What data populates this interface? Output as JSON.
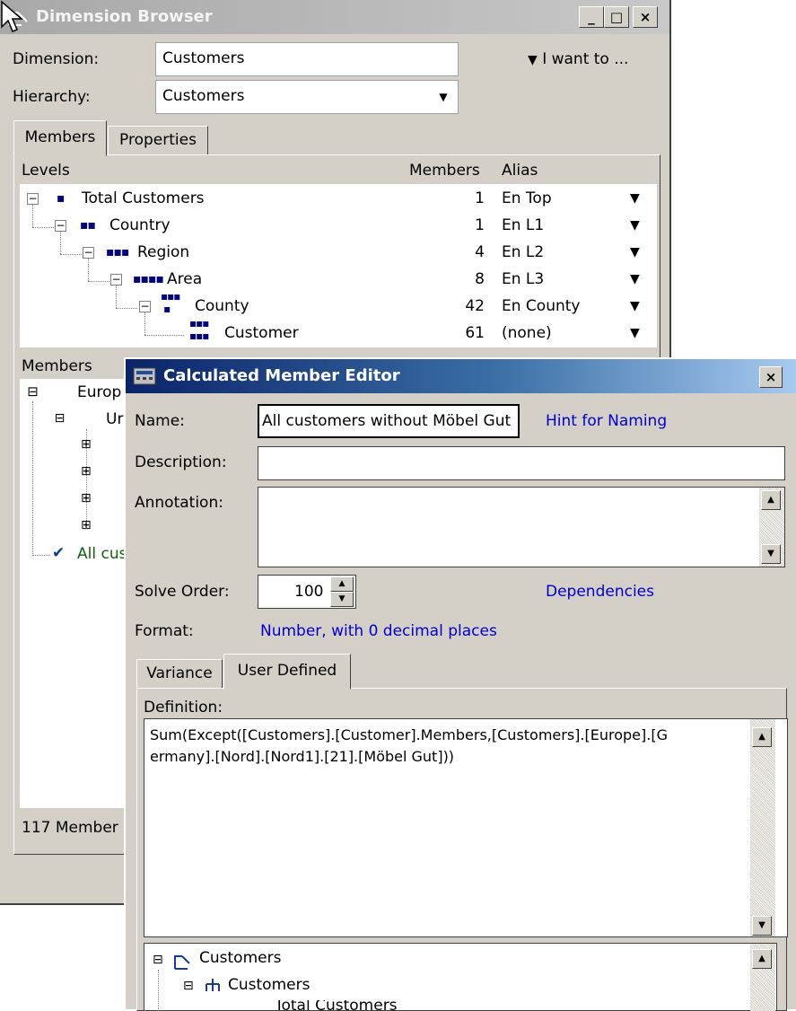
{
  "dimension_browser": {
    "title": "Dimension Browser",
    "dimension_label": "Dimension:",
    "dimension_value": "Customers",
    "hierarchy_label": "Hierarchy:",
    "hierarchy_value": "Customers",
    "i_want_to": "I want to ...",
    "tabs": {
      "members": "Members",
      "properties": "Properties"
    },
    "levels_header": {
      "levels": "Levels",
      "members": "Members",
      "alias": "Alias"
    },
    "levels": [
      {
        "name": "Total Customers",
        "count": "1",
        "alias": "En Top"
      },
      {
        "name": "Country",
        "count": "1",
        "alias": "En L1"
      },
      {
        "name": "Region",
        "count": "4",
        "alias": "En L2"
      },
      {
        "name": "Area",
        "count": "8",
        "alias": "En L3"
      },
      {
        "name": "County",
        "count": "42",
        "alias": "En County"
      },
      {
        "name": "Customer",
        "count": "61",
        "alias": "(none)"
      }
    ],
    "members_section_label": "Members",
    "member_tree": {
      "europe": "Europ",
      "united": "Ur",
      "all_customers": "All cus"
    },
    "status": "117 Member"
  },
  "editor": {
    "title": "Calculated Member Editor",
    "name_label": "Name:",
    "name_value": "All customers without Möbel Gut",
    "hint_link": "Hint for Naming",
    "description_label": "Description:",
    "description_value": "",
    "annotation_label": "Annotation:",
    "annotation_value": "",
    "solve_order_label": "Solve Order:",
    "solve_order_value": "100",
    "dependencies_link": "Dependencies",
    "format_label": "Format:",
    "format_value": "Number, with 0 decimal places",
    "tabs": {
      "variance": "Variance",
      "user_defined": "User Defined"
    },
    "definition_label": "Definition:",
    "definition_line1": "Sum(Except([Customers].[Customer].Members,[Customers].[Europe].[G",
    "definition_line2": "ermany].[Nord].[Nord1].[21].[Möbel Gut]))",
    "tree": {
      "root": "Customers",
      "child": "Customers",
      "partial": "Total Customers"
    }
  },
  "icons": {
    "close": "close-icon",
    "minimize": "minimize-icon",
    "maximize": "maximize-icon",
    "dropdown": "chevron-down-icon"
  },
  "colors": {
    "link": "#0000cc",
    "editor_title_start": "#0a246a",
    "editor_title_end": "#a6caf0",
    "level_icon": "#000080",
    "checkmark": "#0a3a9a"
  }
}
